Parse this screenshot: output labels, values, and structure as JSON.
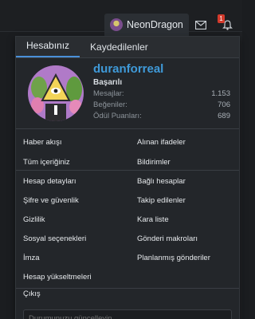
{
  "topbar": {
    "username": "NeonDragon",
    "notification_count": "1"
  },
  "tabs": [
    "Hesabınız",
    "Kaydedilenler"
  ],
  "profile": {
    "name": "duranforreal",
    "title": "Başarılı",
    "stats": [
      {
        "label": "Mesajlar:",
        "value": "1.153"
      },
      {
        "label": "Beğeniler:",
        "value": "706"
      },
      {
        "label": "Ödül Puanları:",
        "value": "689"
      }
    ]
  },
  "links": {
    "left": [
      "Haber akışı",
      "Tüm içeriğiniz",
      "Hesap detayları",
      "Şifre ve güvenlik",
      "Gizlilik",
      "Sosyal seçenekleri",
      "İmza",
      "Hesap yükseltmeleri"
    ],
    "right": [
      "Alınan ifadeler",
      "Bildirimler",
      "Bağlı hesaplar",
      "Takip edilenler",
      "Kara liste",
      "Gönderi makroları",
      "Planlanmış gönderiler"
    ],
    "logout": "Çıkış"
  },
  "status": {
    "placeholder": "Durumunuzu güncelleyin..."
  }
}
